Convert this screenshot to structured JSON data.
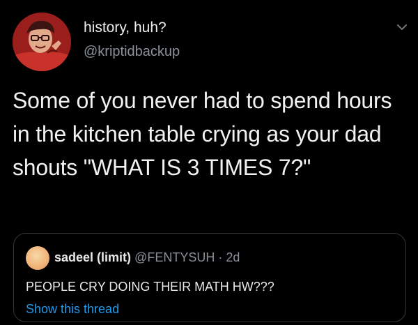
{
  "tweet": {
    "author": {
      "display_name": "history, huh?",
      "handle": "@kriptidbackup"
    },
    "text": "Some of you never had to spend hours in the kitchen table crying as your dad shouts \"WHAT IS 3 TIMES 7?\"",
    "menu_icon": "chevron-down-icon"
  },
  "quote": {
    "author_name": "sadeel (limit)",
    "handle": "@FENTYSUH",
    "separator": "·",
    "time": "2d",
    "text": "PEOPLE CRY DOING THEIR MATH HW???",
    "show_thread_label": "Show this thread"
  },
  "colors": {
    "background": "#000000",
    "text_primary": "#e7e9ea",
    "text_secondary": "#8b9199",
    "link": "#1d9bf0",
    "border": "#333639"
  }
}
